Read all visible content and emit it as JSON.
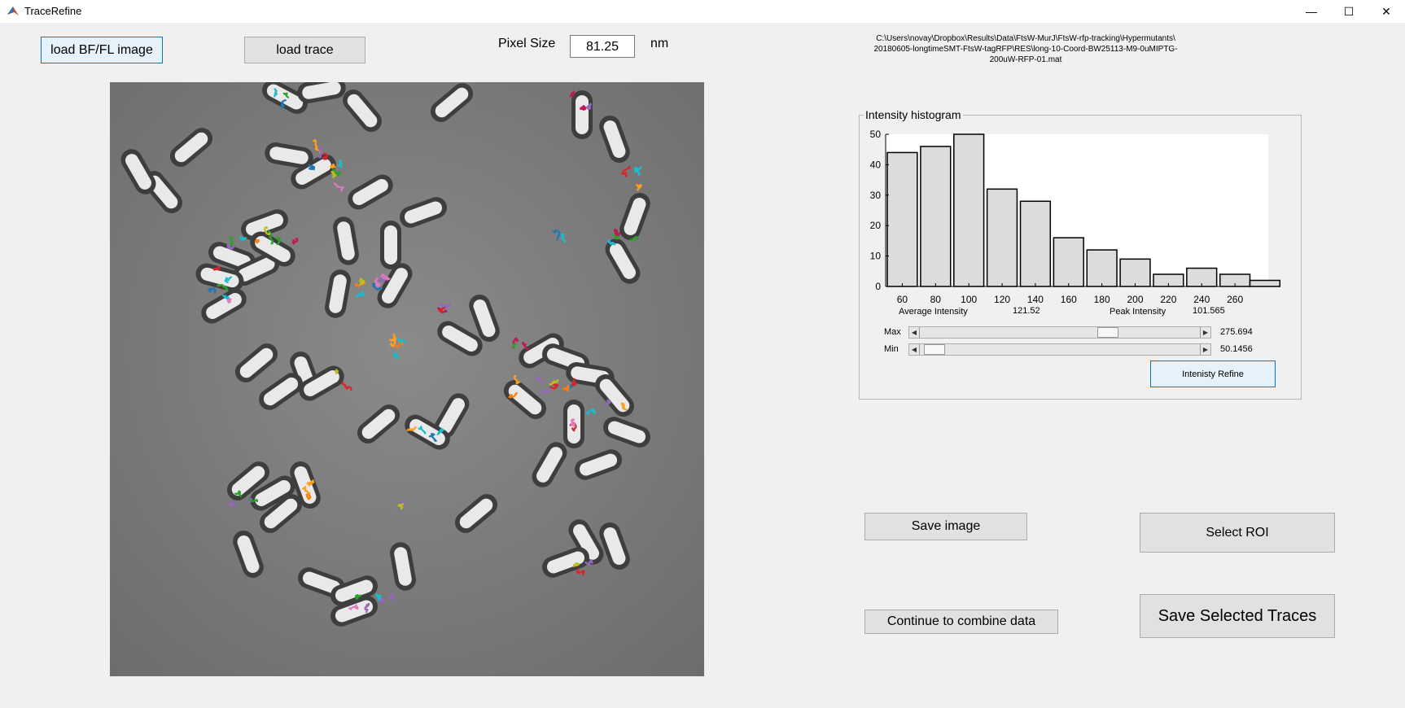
{
  "window": {
    "title": "TraceRefine",
    "minimize": "—",
    "maximize": "☐",
    "close": "✕"
  },
  "toolbar": {
    "load_bf_fl": "load BF/FL image",
    "load_trace": "load trace",
    "pixel_size_label": "Pixel Size",
    "pixel_size_value": "81.25",
    "pixel_unit": "nm"
  },
  "file_path": {
    "line1": "C:\\Users\\novay\\Dropbox\\Results\\Data\\FtsW-MurJ\\FtsW-rfp-tracking\\Hypermutants\\",
    "line2": "20180605-longtimeSMT-FtsW-tagRFP\\RES\\long-10-Coord-BW25113-M9-0uMIPTG-",
    "line3": "200uW-RFP-01.mat"
  },
  "histogram": {
    "panel_title": "Intensity histogram",
    "avg_label": "Average Intensity",
    "avg_value": "121.52",
    "peak_label": "Peak Intensity",
    "peak_value": "101.565",
    "max_label": "Max",
    "max_value": "275.694",
    "min_label": "Min",
    "min_value": "50.1456",
    "max_fraction": 0.68,
    "min_fraction": 0.02,
    "refine_button": "Intenisty Refine"
  },
  "chart_data": {
    "type": "bar",
    "title": "",
    "xlabel": "",
    "ylabel": "",
    "x_ticks": [
      "60",
      "80",
      "100",
      "120",
      "140",
      "160",
      "180",
      "200",
      "220",
      "240",
      "260"
    ],
    "y_ticks": [
      "0",
      "10",
      "20",
      "30",
      "40",
      "50"
    ],
    "xlim": [
      50,
      280
    ],
    "ylim": [
      0,
      50
    ],
    "bins": [
      60,
      80,
      100,
      120,
      140,
      160,
      180,
      200,
      220,
      240,
      260,
      278
    ],
    "values": [
      44,
      46,
      50,
      32,
      28,
      16,
      12,
      9,
      4,
      6,
      4,
      2
    ]
  },
  "actions": {
    "save_image": "Save image",
    "select_roi": "Select ROI",
    "continue_combine": "Continue to combine data",
    "save_selected_traces": "Save Selected Traces"
  }
}
